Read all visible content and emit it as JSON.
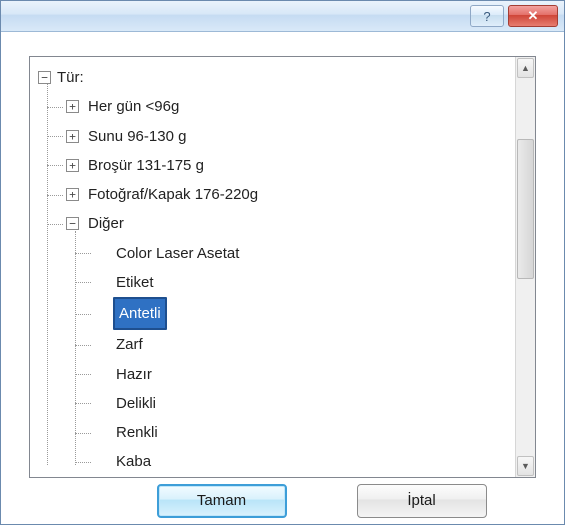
{
  "titlebar": {
    "help_label": "?",
    "close_label": "✕"
  },
  "tree": {
    "root_label": "Tür:",
    "root_expanded": true,
    "categories": [
      {
        "label": "Her gün <96g",
        "expanded": false
      },
      {
        "label": "Sunu 96-130 g",
        "expanded": false
      },
      {
        "label": "Broşür 131-175 g",
        "expanded": false
      },
      {
        "label": "Fotoğraf/Kapak 176-220g",
        "expanded": false
      },
      {
        "label": "Diğer",
        "expanded": true,
        "children": [
          {
            "label": "Color Laser Asetat",
            "selected": false
          },
          {
            "label": "Etiket",
            "selected": false
          },
          {
            "label": "Antetli",
            "selected": true
          },
          {
            "label": "Zarf",
            "selected": false
          },
          {
            "label": "Hazır",
            "selected": false
          },
          {
            "label": "Delikli",
            "selected": false
          },
          {
            "label": "Renkli",
            "selected": false
          },
          {
            "label": "Kaba",
            "selected": false
          }
        ]
      }
    ]
  },
  "buttons": {
    "ok": "Tamam",
    "cancel": "İptal"
  }
}
